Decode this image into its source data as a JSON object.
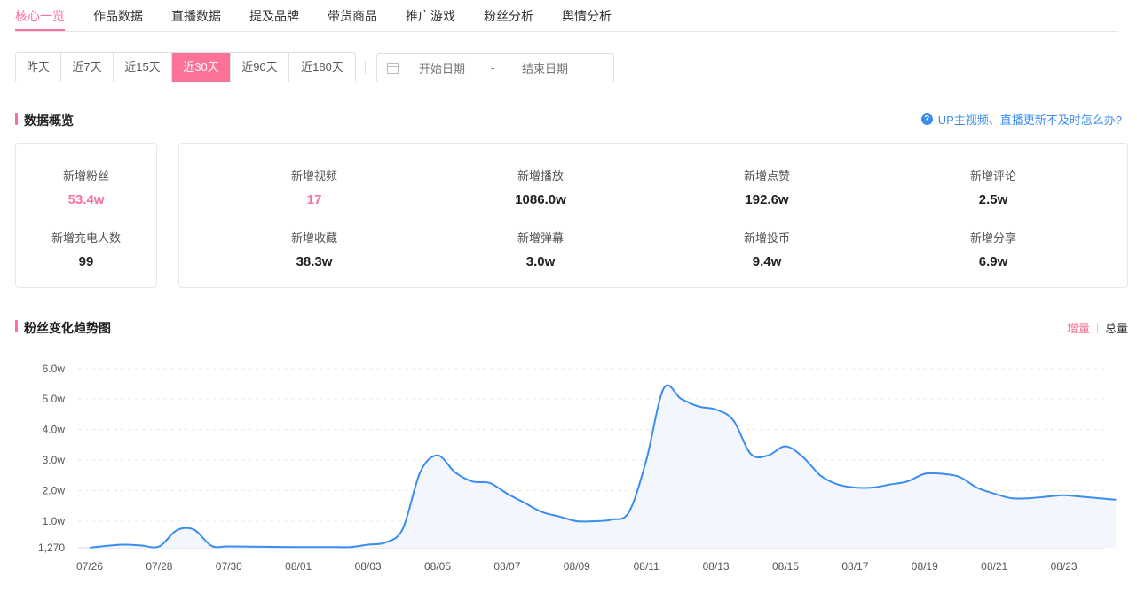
{
  "tabs": [
    "核心一览",
    "作品数据",
    "直播数据",
    "提及品牌",
    "带货商品",
    "推广游戏",
    "粉丝分析",
    "舆情分析"
  ],
  "active_tab": 0,
  "ranges": [
    "昨天",
    "近7天",
    "近15天",
    "近30天",
    "近90天",
    "近180天"
  ],
  "active_range": 3,
  "datepicker": {
    "start_placeholder": "开始日期",
    "separator": "-",
    "end_placeholder": "结束日期"
  },
  "overview": {
    "title": "数据概览",
    "help_text": "UP主视频、直播更新不及时怎么办?",
    "help_icon": "question-circle-icon",
    "left": [
      {
        "label": "新增粉丝",
        "value": "53.4w",
        "highlight": true
      },
      {
        "label": "新增充电人数",
        "value": "99",
        "highlight": false
      }
    ],
    "right": [
      {
        "label": "新增视频",
        "value": "17",
        "highlight": true
      },
      {
        "label": "新增播放",
        "value": "1086.0w",
        "highlight": false
      },
      {
        "label": "新增点赞",
        "value": "192.6w",
        "highlight": false
      },
      {
        "label": "新增评论",
        "value": "2.5w",
        "highlight": false
      },
      {
        "label": "新增收藏",
        "value": "38.3w",
        "highlight": false
      },
      {
        "label": "新增弹幕",
        "value": "3.0w",
        "highlight": false
      },
      {
        "label": "新增投币",
        "value": "9.4w",
        "highlight": false
      },
      {
        "label": "新增分享",
        "value": "6.9w",
        "highlight": false
      }
    ]
  },
  "trend": {
    "title": "粉丝变化趋势图",
    "toggle": [
      "增量",
      "总量"
    ],
    "active_toggle": 0
  },
  "colors": {
    "accent": "#fb7299",
    "line": "#3a8df0",
    "area": "#f3f7fd",
    "link": "#3a8df0"
  },
  "chart_data": {
    "type": "area",
    "title": "",
    "xlabel": "",
    "ylabel": "",
    "y_ticks": [
      "1,270",
      "1.0w",
      "2.0w",
      "3.0w",
      "4.0w",
      "5.0w",
      "6.0w"
    ],
    "y_tick_values": [
      1270,
      10000,
      20000,
      30000,
      40000,
      50000,
      60000
    ],
    "ylim": [
      1270,
      60000
    ],
    "x_ticks": [
      "07/26",
      "07/28",
      "07/30",
      "08/01",
      "08/03",
      "08/05",
      "08/07",
      "08/09",
      "08/11",
      "08/13",
      "08/15",
      "08/17",
      "08/19",
      "08/21",
      "08/23"
    ],
    "grid": true,
    "legend": "none",
    "x": [
      0,
      0.5,
      1,
      1.5,
      2,
      2.5,
      3,
      3.5,
      4,
      5,
      6,
      7,
      7.5,
      8,
      8.5,
      9,
      9.5,
      10,
      10.5,
      11,
      11.5,
      12,
      12.5,
      13,
      13.5,
      14,
      14.5,
      15,
      15.5,
      16,
      16.5,
      17,
      17.5,
      18,
      18.5,
      19,
      19.5,
      20,
      20.5,
      21,
      21.5,
      22,
      22.5,
      23,
      23.5,
      24,
      24.5,
      25,
      25.5,
      26,
      26.5,
      27,
      27.5,
      28,
      28.5,
      29,
      29.5
    ],
    "values": [
      1270,
      1900,
      2300,
      2000,
      1700,
      7000,
      7200,
      1900,
      1700,
      1600,
      1500,
      1500,
      1500,
      2300,
      3000,
      7500,
      26000,
      31500,
      26000,
      23000,
      22500,
      19000,
      16000,
      13000,
      11500,
      10000,
      10000,
      10500,
      13000,
      30000,
      53500,
      50000,
      47500,
      46500,
      43000,
      32000,
      31500,
      34500,
      31000,
      25000,
      22000,
      21000,
      21000,
      22000,
      23000,
      25500,
      25500,
      24500,
      21000,
      19000,
      17500,
      17500,
      18000,
      18500,
      18000,
      17500,
      17000
    ]
  }
}
